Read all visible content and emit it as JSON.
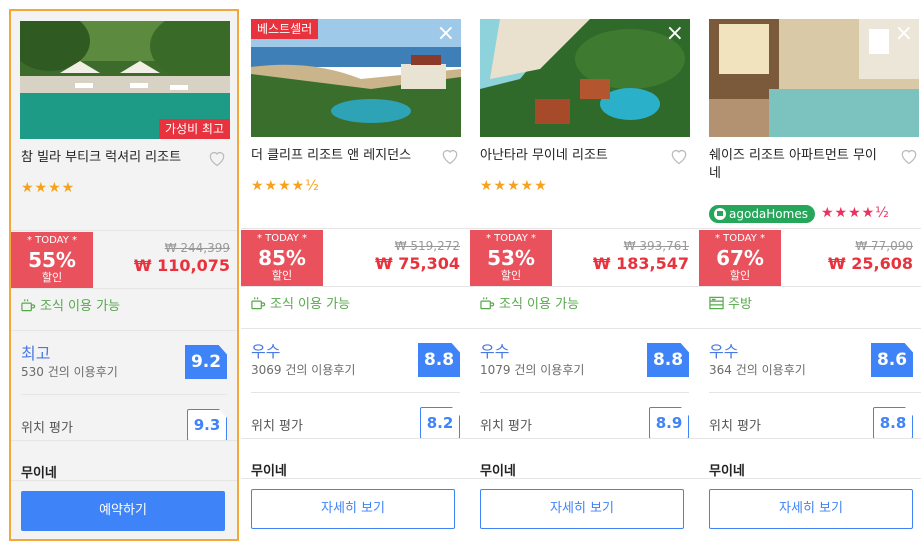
{
  "hotels": [
    {
      "name": "참 빌라 부티크 럭셔리 리조트",
      "ribbon": "가성비 최고",
      "stars": "★★★★",
      "today": "* TODAY *",
      "discount": "55%",
      "discount_label": "할인",
      "original_price": "₩ 244,399",
      "price": "₩ 110,075",
      "feature": "조식 이용 가능",
      "review_label": "최고",
      "review_count": "530 건의 이용후기",
      "score": "9.2",
      "location_label": "위치 평가",
      "location_score": "9.3",
      "city": "무이네",
      "button": "예약하기"
    },
    {
      "name": "더 클리프 리조트 앤 레지던스",
      "ribbon": "베스트셀러",
      "stars": "★★★★½",
      "today": "* TODAY *",
      "discount": "85%",
      "discount_label": "할인",
      "original_price": "₩ 519,272",
      "price": "₩ 75,304",
      "feature": "조식 이용 가능",
      "review_label": "우수",
      "review_count": "3069 건의 이용후기",
      "score": "8.8",
      "location_label": "위치 평가",
      "location_score": "8.2",
      "city": "무이네",
      "button": "자세히 보기"
    },
    {
      "name": "아난타라 무이네 리조트",
      "stars": "★★★★★",
      "today": "* TODAY *",
      "discount": "53%",
      "discount_label": "할인",
      "original_price": "₩ 393,761",
      "price": "₩ 183,547",
      "feature": "조식 이용 가능",
      "review_label": "우수",
      "review_count": "1079 건의 이용후기",
      "score": "8.8",
      "location_label": "위치 평가",
      "location_score": "8.9",
      "city": "무이네",
      "button": "자세히 보기"
    },
    {
      "name": "쉐이즈 리조트 아파트먼트 무이네",
      "agoda": "agodaHomes",
      "stars": "★★★★½",
      "today": "* TODAY *",
      "discount": "67%",
      "discount_label": "할인",
      "original_price": "₩ 77,090",
      "price": "₩ 25,608",
      "feature": "주방",
      "review_label": "우수",
      "review_count": "364 건의 이용후기",
      "score": "8.6",
      "location_label": "위치 평가",
      "location_score": "8.8",
      "city": "무이네",
      "button": "자세히 보기"
    }
  ],
  "colors": {
    "accent": "#3f83f8",
    "sale": "#e9525c",
    "highlight": "#f3a93a",
    "feature": "#56a94b"
  },
  "icons": {
    "close": "×",
    "heart": "heart-icon",
    "coffee": "coffee-icon",
    "kitchen": "kitchen-icon"
  }
}
